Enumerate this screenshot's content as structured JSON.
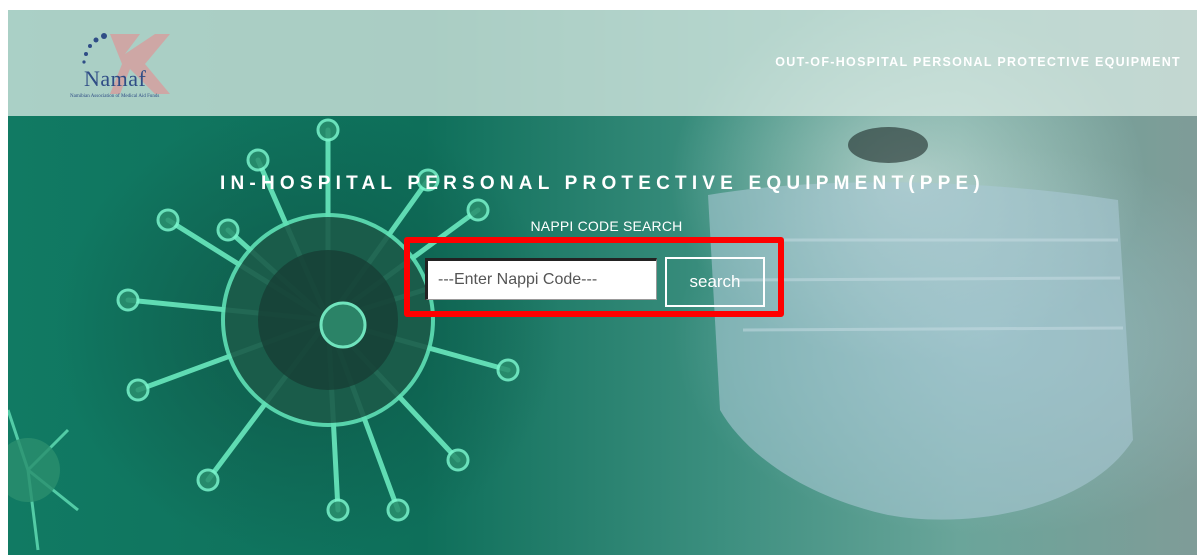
{
  "header": {
    "logo": {
      "name": "Namaf",
      "subtitle": "Namibian Association of Medical Aid Funds"
    },
    "nav_link": "OUT-OF-HOSPITAL PERSONAL PROTECTIVE EQUIPMENT"
  },
  "hero": {
    "title": "IN-HOSPITAL PERSONAL PROTECTIVE EQUIPMENT(PPE)",
    "subtitle": "NAPPI CODE SEARCH"
  },
  "search": {
    "placeholder": "---Enter Nappi Code---",
    "value": "",
    "button_label": "search"
  },
  "colors": {
    "highlight": "#ff0000",
    "hero_green": "#117a63",
    "logo_blue": "#2f4d86"
  },
  "icons": [
    "virus-image",
    "mask-photo"
  ]
}
